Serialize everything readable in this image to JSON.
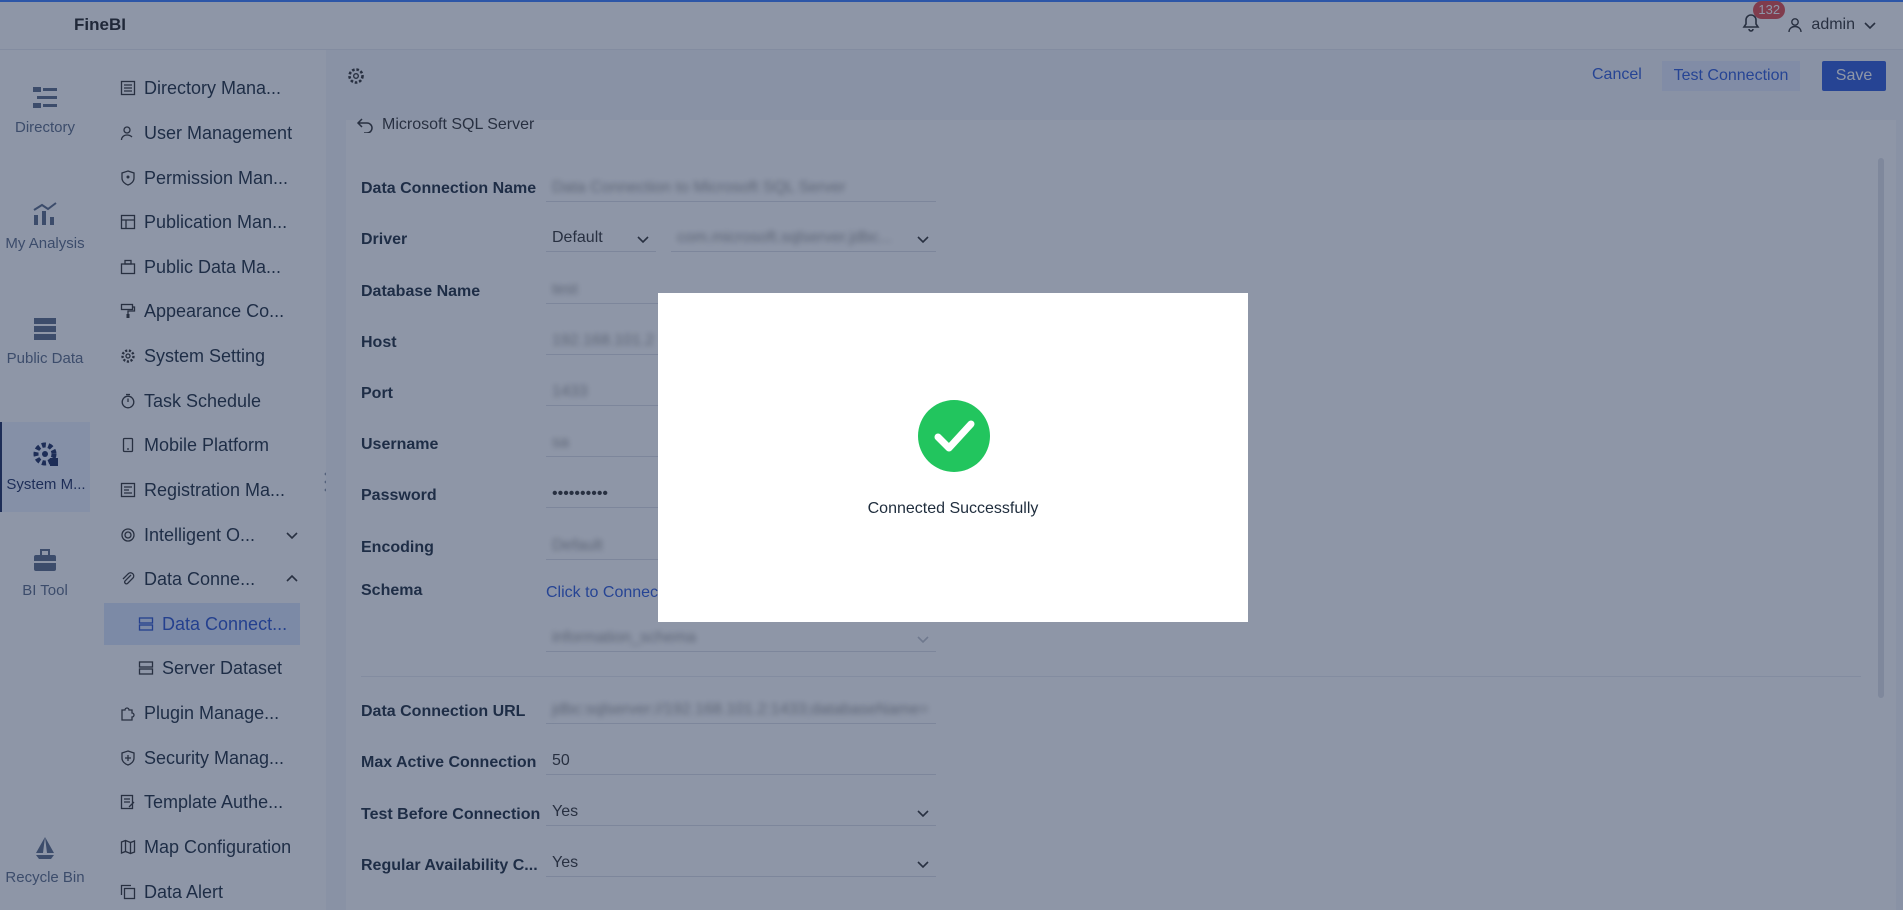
{
  "app": {
    "title": "FineBI"
  },
  "header": {
    "notification_count": "132",
    "user": "admin"
  },
  "rail": {
    "items": [
      {
        "label": "Directory"
      },
      {
        "label": "My Analysis"
      },
      {
        "label": "Public Data"
      },
      {
        "label": "System M..."
      },
      {
        "label": "BI Tool"
      },
      {
        "label": "Recycle Bin"
      }
    ]
  },
  "menu": {
    "items": [
      {
        "label": "Directory Mana..."
      },
      {
        "label": "User Management"
      },
      {
        "label": "Permission Man..."
      },
      {
        "label": "Publication Man..."
      },
      {
        "label": "Public Data Ma..."
      },
      {
        "label": "Appearance Co..."
      },
      {
        "label": "System Setting"
      },
      {
        "label": "Task Schedule"
      },
      {
        "label": "Mobile Platform"
      },
      {
        "label": "Registration Ma..."
      },
      {
        "label": "Intelligent O..."
      },
      {
        "label": "Data Conne..."
      },
      {
        "label": "Data Connect..."
      },
      {
        "label": "Server Dataset"
      },
      {
        "label": "Plugin Manage..."
      },
      {
        "label": "Security Manag..."
      },
      {
        "label": "Template Authe..."
      },
      {
        "label": "Map Configuration"
      },
      {
        "label": "Data Alert"
      }
    ]
  },
  "toolbar": {
    "cancel": "Cancel",
    "test": "Test Connection",
    "save": "Save"
  },
  "page": {
    "back_title": "Microsoft SQL Server"
  },
  "form": {
    "connection_name": {
      "label": "Data Connection Name",
      "value": "Data Connection to Microsoft SQL Server"
    },
    "driver": {
      "label": "Driver",
      "mode": "Default",
      "value": "com.microsoft.sqlserver.jdbc..."
    },
    "database": {
      "label": "Database Name",
      "value": "test"
    },
    "host": {
      "label": "Host",
      "value": "192.168.101.2"
    },
    "port": {
      "label": "Port",
      "value": "1433"
    },
    "username": {
      "label": "Username",
      "value": "sa"
    },
    "password": {
      "label": "Password",
      "value": "••••••••••"
    },
    "encoding": {
      "label": "Encoding",
      "value": "Default"
    },
    "schema": {
      "label": "Schema",
      "link": "Click to Connect",
      "value": "information_schema"
    },
    "url": {
      "label": "Data Connection URL",
      "value": "jdbc:sqlserver://192.168.101.2:1433;databaseName="
    },
    "max_active": {
      "label": "Max Active Connection",
      "value": "50"
    },
    "test_before": {
      "label": "Test Before Connection",
      "value": "Yes"
    },
    "availability": {
      "label": "Regular Availability C...",
      "value": "Yes"
    }
  },
  "modal": {
    "message": "Connected Successfully"
  },
  "colors": {
    "accent": "#2f5bd8",
    "success": "#22c55e",
    "badge": "#e34b4b"
  }
}
